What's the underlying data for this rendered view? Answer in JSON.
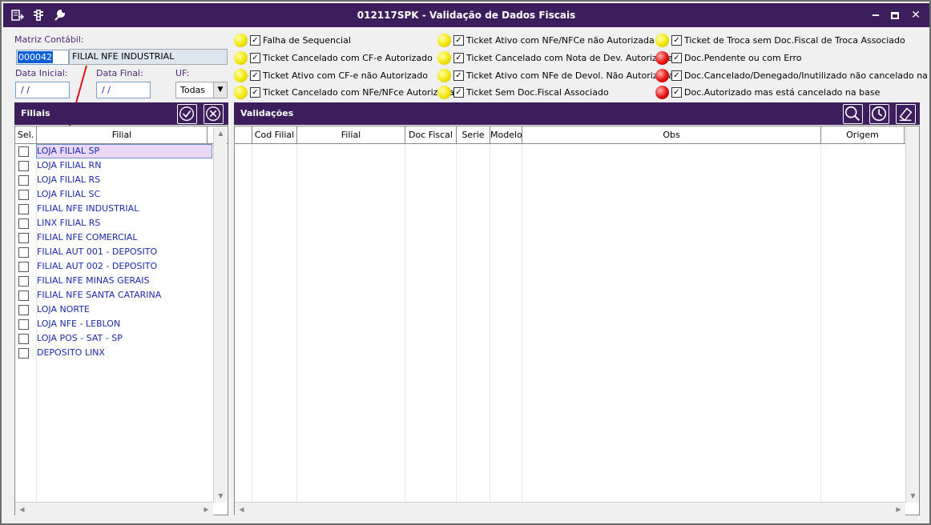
{
  "window": {
    "title": "012117SPK - Validação de Dados Fiscais",
    "buttons": [
      "minimize",
      "maximize",
      "close"
    ]
  },
  "toolbar_icons": [
    "export-icon",
    "traffic-light-icon",
    "wrench-icon"
  ],
  "filters": {
    "matriz_label": "Matriz Contábil:",
    "matriz_code": "000042",
    "matriz_name": "FILIAL NFE INDUSTRIAL",
    "data_inicial_label": "Data Inicial:",
    "data_inicial_value": "/ /",
    "data_final_label": "Data Final:",
    "data_final_value": "/ /",
    "uf_label": "UF:",
    "uf_value": "Todas"
  },
  "legend": [
    {
      "color": "yellow",
      "checked": true,
      "text": "Falha de Sequencial"
    },
    {
      "color": "yellow",
      "checked": true,
      "text": "Ticket Cancelado com CF-e Autorizado"
    },
    {
      "color": "yellow",
      "checked": true,
      "text": "Ticket Ativo com CF-e não Autorizado"
    },
    {
      "color": "yellow",
      "checked": true,
      "text": "Ticket Cancelado com NFe/NFce Autorizada"
    },
    {
      "color": "yellow",
      "checked": true,
      "text": "Ticket Ativo com NFe/NFCe não Autorizada"
    },
    {
      "color": "yellow",
      "checked": true,
      "text": "Ticket Cancelado com Nota de Dev. Autorizada"
    },
    {
      "color": "yellow",
      "checked": true,
      "text": "Ticket Ativo com NFe de Devol. Não Autorizada"
    },
    {
      "color": "yellow",
      "checked": true,
      "text": "Ticket Sem Doc.Fiscal Associado"
    },
    {
      "color": "yellow",
      "checked": true,
      "text": "Ticket de Troca sem Doc.Fiscal de Troca Associado"
    },
    {
      "color": "red",
      "checked": true,
      "text": "Doc.Pendente ou com Erro"
    },
    {
      "color": "red",
      "checked": true,
      "text": "Doc.Cancelado/Denegado/Inutilizado não cancelado na base"
    },
    {
      "color": "red",
      "checked": true,
      "text": "Doc.Autorizado mas está cancelado na base"
    }
  ],
  "filiais": {
    "title": "Filiais",
    "col_sel": "Sel.",
    "col_filial": "Filial",
    "rows": [
      "LOJA FILIAL SP",
      "LOJA FILIAL RN",
      "LOJA FILIAL RS",
      "LOJA FILIAL SC",
      "FILIAL NFE INDUSTRIAL",
      "LINX FILIAL RS",
      "FILIAL NFE COMERCIAL",
      "FILIAL AUT 001 - DEPOSITO",
      "FILIAL AUT 002 - DEPOSITO",
      "FILIAL NFE MINAS GERAIS",
      "FILIAL NFE SANTA CATARINA",
      "LOJA NORTE",
      "LOJA NFE - LEBLON",
      "LOJA POS - SAT - SP",
      "DEPOSITO LINX"
    ]
  },
  "validacoes": {
    "title": "Validações",
    "columns": [
      "",
      "Cod Filial",
      "Filial",
      "Doc Fiscal",
      "Serie",
      "Modelo",
      "Obs",
      "Origem"
    ]
  }
}
